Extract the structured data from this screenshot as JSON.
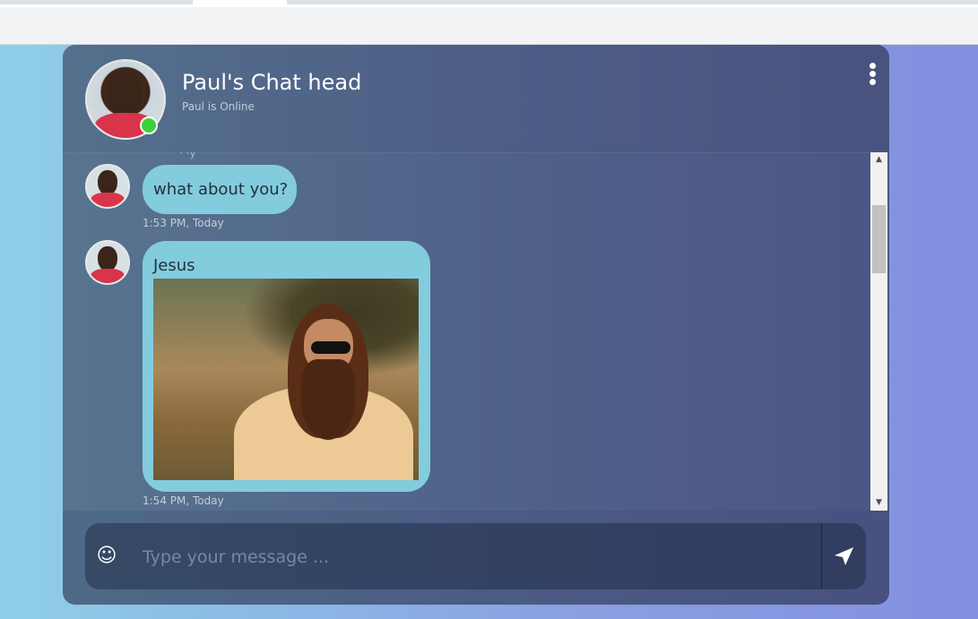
{
  "header": {
    "title": "Paul's Chat head",
    "status": "Paul is Online"
  },
  "messages": [
    {
      "text": "what about you?",
      "time": "1:53 PM, Today"
    },
    {
      "text": "Jesus",
      "time": "1:54 PM, Today",
      "has_image": true
    }
  ],
  "composer": {
    "placeholder": "Type your message ..."
  },
  "icons": {
    "menu": "more-vertical-icon",
    "emoji": "smile-icon",
    "send": "send-arrow-icon"
  },
  "colors": {
    "bubble": "#82ccdd",
    "online": "#3ed137"
  }
}
